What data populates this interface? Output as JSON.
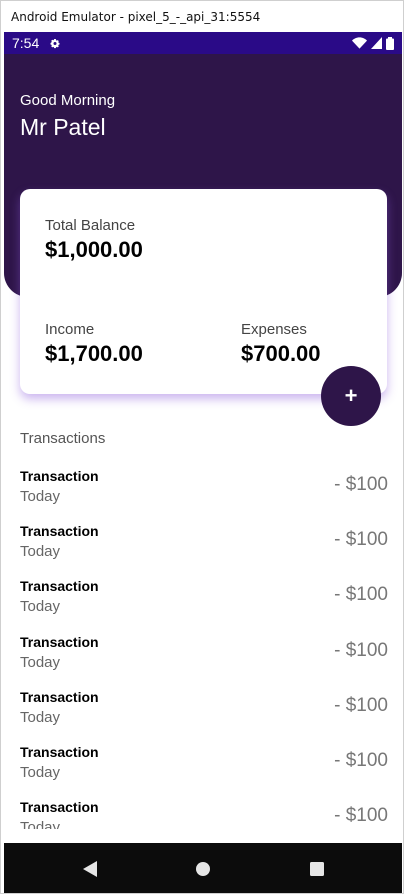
{
  "window": {
    "title": "Android Emulator - pixel_5_-_api_31:5554"
  },
  "statusbar": {
    "time": "7:54",
    "icons": [
      "gear-icon",
      "wifi-icon",
      "signal-icon",
      "battery-icon"
    ]
  },
  "header": {
    "greeting": "Good Morning",
    "username": "Mr Patel",
    "bg_color": "#2e1549"
  },
  "balance_card": {
    "total_label": "Total Balance",
    "total_value": "$1,000.00",
    "income_label": "Income",
    "income_value": "$1,700.00",
    "expenses_label": "Expenses",
    "expenses_value": "$700.00"
  },
  "fab": {
    "label": "+"
  },
  "transactions": {
    "title": "Transactions",
    "items": [
      {
        "name": "Transaction",
        "date": "Today",
        "amount": "- $100"
      },
      {
        "name": "Transaction",
        "date": "Today",
        "amount": "- $100"
      },
      {
        "name": "Transaction",
        "date": "Today",
        "amount": "- $100"
      },
      {
        "name": "Transaction",
        "date": "Today",
        "amount": "- $100"
      },
      {
        "name": "Transaction",
        "date": "Today",
        "amount": "- $100"
      },
      {
        "name": "Transaction",
        "date": "Today",
        "amount": "- $100"
      },
      {
        "name": "Transaction",
        "date": "Today",
        "amount": "- $100"
      }
    ]
  },
  "navbar": {
    "icons": [
      "back-icon",
      "home-icon",
      "recents-icon"
    ]
  }
}
